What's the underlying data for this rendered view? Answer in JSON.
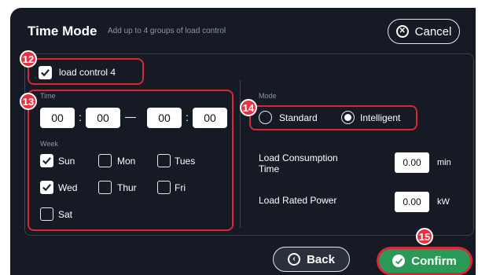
{
  "header": {
    "title": "Time  Mode",
    "subtitle": "Add up to 4 groups of load control",
    "cancel_label": "Cancel"
  },
  "load_control": {
    "label": "load control 4",
    "checked": true
  },
  "time": {
    "label": "Time",
    "start_hour": "00",
    "start_minute": "00",
    "end_hour": "00",
    "end_minute": "00",
    "colon": ":",
    "dash": "—"
  },
  "week": {
    "label": "Week",
    "days": [
      {
        "label": "Sun",
        "checked": true
      },
      {
        "label": "Mon",
        "checked": false
      },
      {
        "label": "Tues",
        "checked": false
      },
      {
        "label": "Wed",
        "checked": true
      },
      {
        "label": "Thur",
        "checked": false
      },
      {
        "label": "Fri",
        "checked": false
      },
      {
        "label": "Sat",
        "checked": false
      }
    ]
  },
  "mode": {
    "label": "Mode",
    "options": [
      {
        "label": "Standard",
        "selected": false
      },
      {
        "label": "Intelligent",
        "selected": true
      }
    ]
  },
  "consumption": {
    "label_line1": "Load Consumption",
    "label_line2": "Time",
    "value": "0.00",
    "unit": "min"
  },
  "rated_power": {
    "label": "Load Rated Power",
    "value": "0.00",
    "unit": "kW"
  },
  "footer": {
    "back_label": "Back",
    "confirm_label": "Confirm"
  },
  "badges": {
    "b12": "12",
    "b13": "13",
    "b14": "14",
    "b15": "15"
  },
  "colors": {
    "background": "#151a24",
    "accent_red": "#d9273a",
    "confirm_green": "#2c9a57",
    "badge_red": "#e63340"
  }
}
